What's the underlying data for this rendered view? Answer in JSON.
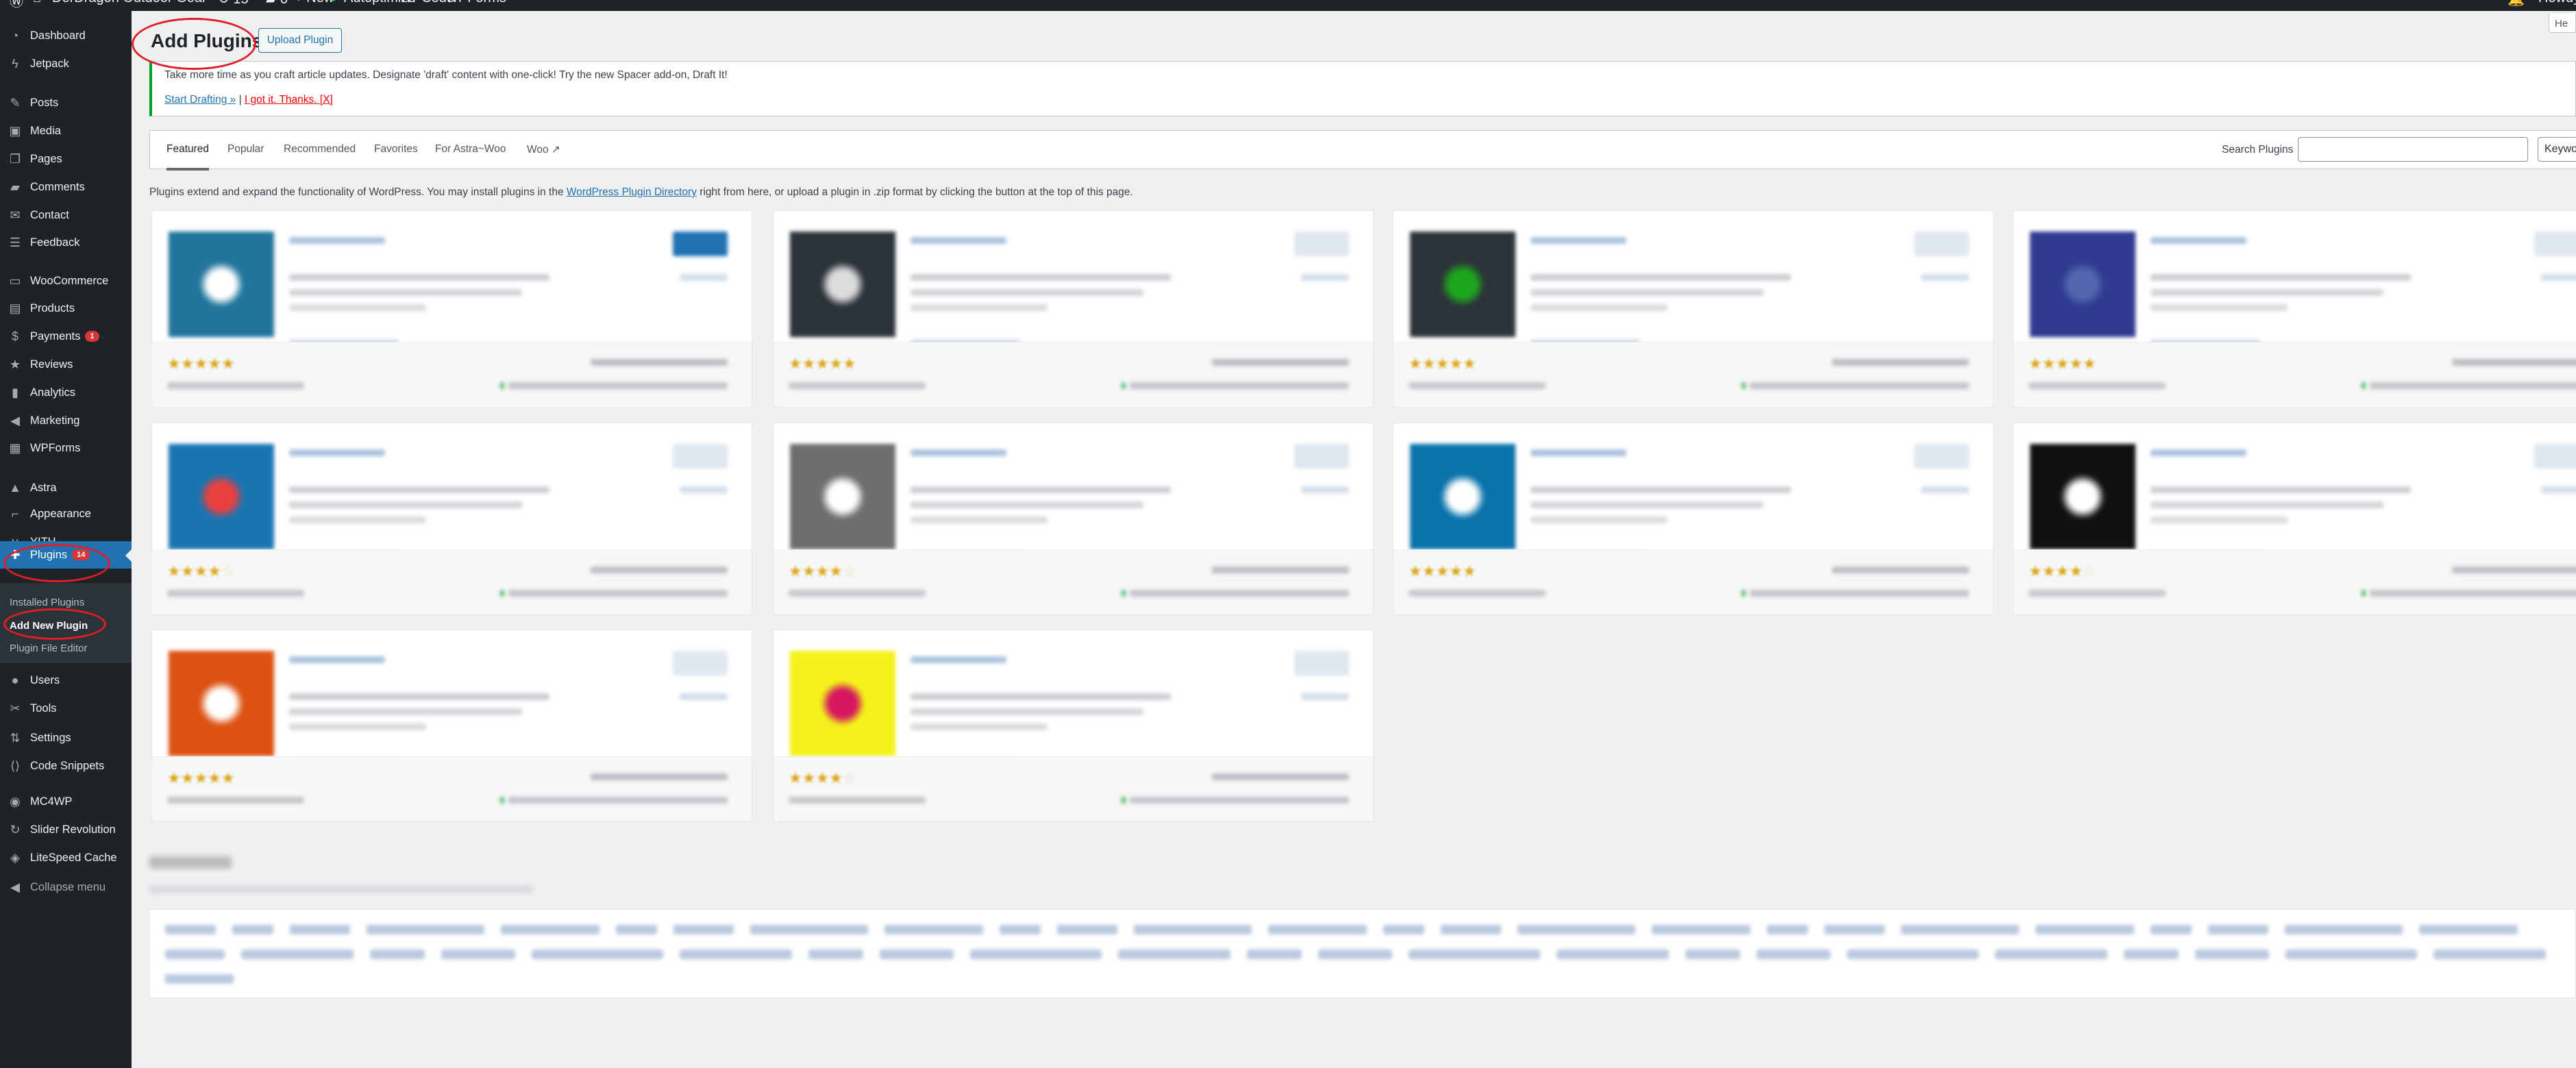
{
  "admin_bar": {
    "site_name": "DerDragon Outdoor Gear",
    "updates_count": "15",
    "comments_count": "0",
    "new_label": "New",
    "items": [
      "Autoptimize",
      "WPCode",
      "WPForms"
    ],
    "howdy": "Howdy,"
  },
  "sidebar": {
    "items": [
      {
        "label": "Dashboard",
        "icon": "dashboard-icon"
      },
      {
        "label": "Jetpack",
        "icon": "jetpack-icon"
      },
      {
        "label": "Posts",
        "icon": "pin-icon"
      },
      {
        "label": "Media",
        "icon": "media-icon"
      },
      {
        "label": "Pages",
        "icon": "pages-icon"
      },
      {
        "label": "Comments",
        "icon": "comment-icon"
      },
      {
        "label": "Contact",
        "icon": "envelope-icon"
      },
      {
        "label": "Feedback",
        "icon": "feedback-icon"
      },
      {
        "label": "WooCommerce",
        "icon": "woo-icon"
      },
      {
        "label": "Products",
        "icon": "archive-icon"
      },
      {
        "label": "Payments",
        "icon": "dollar-icon",
        "badge": "1"
      },
      {
        "label": "Reviews",
        "icon": "star-icon"
      },
      {
        "label": "Analytics",
        "icon": "bar-chart-icon"
      },
      {
        "label": "Marketing",
        "icon": "megaphone-icon"
      },
      {
        "label": "WPForms",
        "icon": "forms-icon"
      },
      {
        "label": "Astra",
        "icon": "astra-icon"
      },
      {
        "label": "Appearance",
        "icon": "brush-icon"
      },
      {
        "label": "YITH",
        "icon": "yith-icon"
      },
      {
        "label": "Plugins",
        "icon": "plugin-icon",
        "badge": "14",
        "current": true
      },
      {
        "label": "Users",
        "icon": "user-icon"
      },
      {
        "label": "Tools",
        "icon": "wrench-icon"
      },
      {
        "label": "Settings",
        "icon": "sliders-icon"
      },
      {
        "label": "Code Snippets",
        "icon": "code-icon"
      },
      {
        "label": "MC4WP",
        "icon": "mc4wp-icon"
      },
      {
        "label": "Slider Revolution",
        "icon": "refresh-icon"
      },
      {
        "label": "LiteSpeed Cache",
        "icon": "diamond-icon"
      },
      {
        "label": "Collapse menu",
        "icon": "collapse-icon"
      }
    ],
    "submenu": [
      {
        "label": "Installed Plugins"
      },
      {
        "label": "Add New Plugin",
        "current": true
      },
      {
        "label": "Plugin File Editor"
      }
    ]
  },
  "header": {
    "title": "Add Plugins",
    "upload_button": "Upload Plugin",
    "help_tab": "He"
  },
  "notice": {
    "text": "Take more time as you craft article updates. Designate 'draft' content with one-click! Try the new Spacer add-on, Draft It!",
    "primary_link": "Start Drafting »",
    "separator": "|",
    "dismiss_link": "I got it. Thanks. [X]"
  },
  "filter_bar": {
    "tabs": [
      {
        "label": "Featured",
        "active": true
      },
      {
        "label": "Popular"
      },
      {
        "label": "Recommended"
      },
      {
        "label": "Favorites"
      },
      {
        "label": "For Astra~Woo"
      },
      {
        "label": "Woo ↗"
      }
    ],
    "search_label": "Search Plugins",
    "search_value": "",
    "search_type": "Keyword"
  },
  "description": {
    "before": "Plugins extend and expand the functionality of WordPress. You may install plugins in the ",
    "link": "WordPress Plugin Directory",
    "after": " right from here, or upload a plugin in .zip format by clicking the button at the top of this page."
  },
  "plugin_cards": [
    {
      "icon_color": "#21759b",
      "accent": "#ffffff",
      "rating": 4.5
    },
    {
      "icon_color": "#2c3338",
      "accent": "#dcdcde",
      "rating": 4.5
    },
    {
      "icon_color": "#2c3338",
      "accent": "#1ea51e",
      "rating": 4.5
    },
    {
      "icon_color": "#2e3b8f",
      "accent": "#5566b0",
      "rating": 4.5
    },
    {
      "icon_color": "#1a74b0",
      "accent": "#e8403f",
      "rating": 3.5
    },
    {
      "icon_color": "#6e6e6e",
      "accent": "#ffffff",
      "rating": 3.5
    },
    {
      "icon_color": "#0a73ab",
      "accent": "#ffffff",
      "rating": 4.5
    },
    {
      "icon_color": "#111111",
      "accent": "#ffffff",
      "rating": 3.5
    },
    {
      "icon_color": "#dd5214",
      "accent": "#ffffff",
      "rating": 4.5
    },
    {
      "icon_color": "#f4f21a",
      "accent": "#d6165f",
      "rating": 3.5
    }
  ],
  "colors": {
    "accent": "#2271b1",
    "sidebar": "#1d2327",
    "annotation": "#e01e26"
  }
}
